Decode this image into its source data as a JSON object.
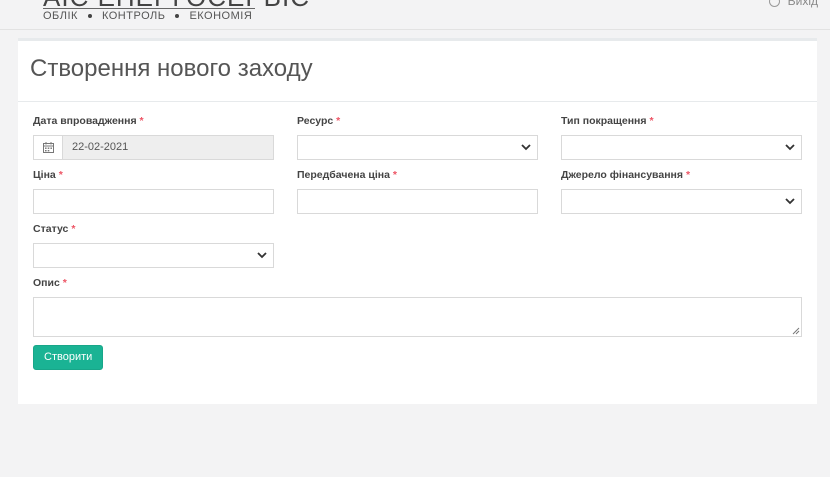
{
  "header": {
    "logo_title": "АІС ЕНЕРГОСЕРВІС",
    "logo_sub": [
      "ОБЛІК",
      "КОНТРОЛЬ",
      "ЕКОНОМІЯ"
    ],
    "user_label": "Вихід"
  },
  "page": {
    "title": "Створення нового заходу"
  },
  "form": {
    "required_mark": "*",
    "date": {
      "label": "Дата впровадження",
      "value": "22-02-2021"
    },
    "resource": {
      "label": "Ресурс",
      "value": ""
    },
    "improvement_type": {
      "label": "Тип покращення",
      "value": ""
    },
    "price": {
      "label": "Ціна",
      "value": ""
    },
    "expected_price": {
      "label": "Передбачена ціна",
      "value": ""
    },
    "funding_source": {
      "label": "Джерело фінансування",
      "value": ""
    },
    "status": {
      "label": "Статус",
      "value": ""
    },
    "description": {
      "label": "Опис",
      "value": ""
    },
    "submit_label": "Створити"
  },
  "colors": {
    "accent": "#1ab394",
    "required": "#ed5565"
  }
}
